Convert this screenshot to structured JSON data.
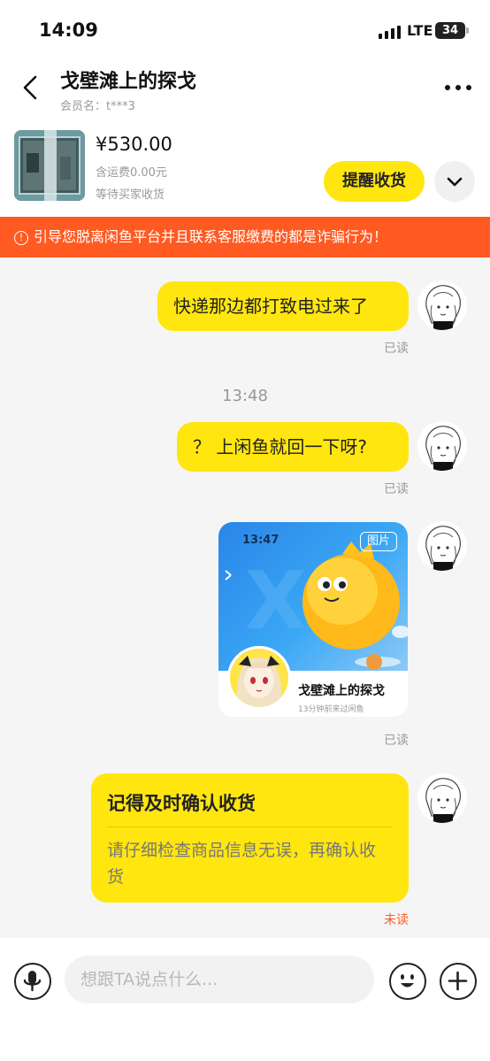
{
  "status_bar": {
    "time": "14:09",
    "network": "LTE",
    "battery": "34"
  },
  "header": {
    "title": "戈壁滩上的探戈",
    "member": "会员名：t***3"
  },
  "product": {
    "price": "¥530.00",
    "shipping": "含运费0.00元",
    "status": "等待买家收货",
    "remind_label": "提醒收货"
  },
  "warning": {
    "text": "引导您脱离闲鱼平台并且联系客服缴费的都是诈骗行为！",
    "icon": "!"
  },
  "messages": [
    {
      "text": "快递那边都打致电过来了",
      "status": "已读"
    },
    {
      "text": "？ 上闲鱼就回一下呀?",
      "status": "已读"
    }
  ],
  "timestamp": "13:48",
  "card": {
    "time": "13:47",
    "tag": "图片",
    "name": "戈壁滩上的探戈",
    "sub": "13分钟前来过闲鱼",
    "status": "已读"
  },
  "notice": {
    "title": "记得及时确认收货",
    "body": "请仔细检查商品信息无误，再确认收货",
    "status": "未读"
  },
  "input": {
    "placeholder": "想跟TA说点什么..."
  },
  "colors": {
    "accent": "#ffe60f",
    "warning": "#ff5a22"
  }
}
